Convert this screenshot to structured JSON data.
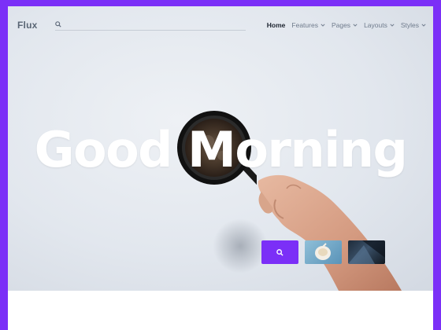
{
  "colors": {
    "accent": "#7b2ff7",
    "hero_bg": "#e3e8ef",
    "title_text": "#ffffff"
  },
  "nav": {
    "logo": "Flux",
    "search": {
      "placeholder": "",
      "value": "",
      "icon": "search-icon"
    },
    "menu": [
      {
        "label": "Home",
        "active": true,
        "has_dropdown": false
      },
      {
        "label": "Features",
        "active": false,
        "has_dropdown": true
      },
      {
        "label": "Pages",
        "active": false,
        "has_dropdown": true
      },
      {
        "label": "Layouts",
        "active": false,
        "has_dropdown": true
      },
      {
        "label": "Styles",
        "active": false,
        "has_dropdown": true
      }
    ]
  },
  "hero": {
    "title": "Good Morning",
    "thumbnails": [
      {
        "kind": "search",
        "icon": "search-icon"
      },
      {
        "kind": "coffee-cup-image"
      },
      {
        "kind": "dark-abstract-image"
      }
    ]
  }
}
